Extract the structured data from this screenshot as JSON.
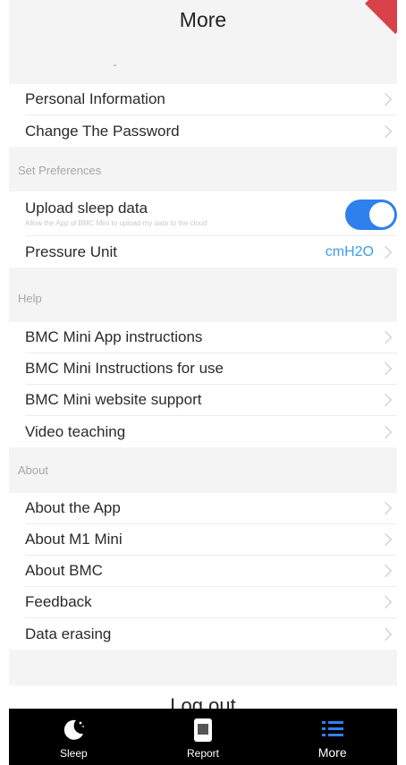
{
  "header": {
    "title": "More"
  },
  "account": {
    "items": [
      {
        "label": "Personal Information"
      },
      {
        "label": "Change The Password"
      }
    ]
  },
  "preferences": {
    "section_label": "Set Preferences",
    "upload": {
      "label": "Upload sleep data",
      "description": "Allow the App of BMC Mini to upload my data to the cloud",
      "enabled": true
    },
    "pressure": {
      "label": "Pressure Unit",
      "value": "cmH2O"
    }
  },
  "help": {
    "section_label": "Help",
    "items": [
      {
        "label": "BMC Mini App instructions"
      },
      {
        "label": "BMC Mini Instructions for use"
      },
      {
        "label": "BMC Mini website support"
      },
      {
        "label": "Video teaching"
      }
    ]
  },
  "about": {
    "section_label": "About",
    "items": [
      {
        "label": "About the App"
      },
      {
        "label": "About M1 Mini"
      },
      {
        "label": "About BMC"
      },
      {
        "label": "Feedback"
      },
      {
        "label": "Data erasing"
      }
    ]
  },
  "logout": {
    "label": "Log out"
  },
  "tabbar": {
    "tabs": [
      {
        "label": "Sleep",
        "icon": "moon-icon"
      },
      {
        "label": "Report",
        "icon": "report-icon"
      },
      {
        "label": "More",
        "icon": "list-icon",
        "active": true
      }
    ]
  },
  "colors": {
    "accent": "#2f80ed",
    "unit_value": "#3aa0e8",
    "tabbar_bg": "#000000",
    "flag": "#d9414a"
  }
}
